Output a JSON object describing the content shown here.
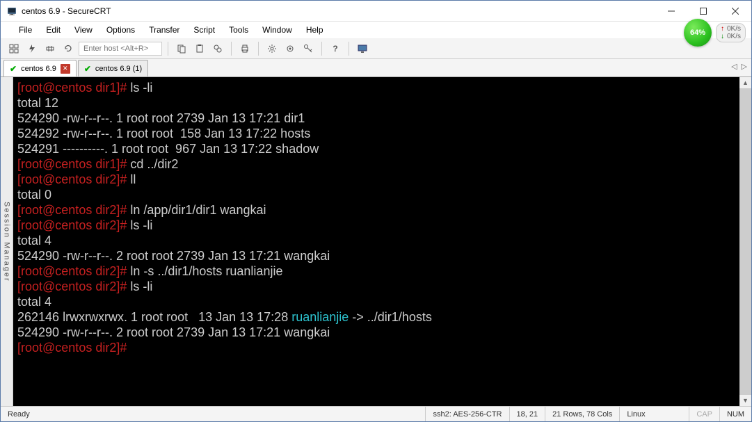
{
  "window": {
    "title": "centos 6.9 - SecureCRT"
  },
  "menu": [
    "File",
    "Edit",
    "View",
    "Options",
    "Transfer",
    "Script",
    "Tools",
    "Window",
    "Help"
  ],
  "speed": {
    "percent": "64%",
    "up": "0K/s",
    "down": "0K/s"
  },
  "toolbar": {
    "host_placeholder": "Enter host <Alt+R>"
  },
  "tabs": [
    {
      "label": "centos 6.9",
      "active": true,
      "close": true
    },
    {
      "label": "centos 6.9 (1)",
      "active": false,
      "close": false
    }
  ],
  "side_label": "Session Manager",
  "terminal": {
    "lines": [
      {
        "seg": [
          {
            "c": "p-red",
            "t": "[root@centos dir1]# "
          },
          {
            "c": "",
            "t": "ls -li"
          }
        ]
      },
      {
        "seg": [
          {
            "c": "",
            "t": "total 12"
          }
        ]
      },
      {
        "seg": [
          {
            "c": "",
            "t": "524290 -rw-r--r--. 1 root root 2739 Jan 13 17:21 dir1"
          }
        ]
      },
      {
        "seg": [
          {
            "c": "",
            "t": "524292 -rw-r--r--. 1 root root  158 Jan 13 17:22 hosts"
          }
        ]
      },
      {
        "seg": [
          {
            "c": "",
            "t": "524291 ----------. 1 root root  967 Jan 13 17:22 shadow"
          }
        ]
      },
      {
        "seg": [
          {
            "c": "p-red",
            "t": "[root@centos dir1]# "
          },
          {
            "c": "",
            "t": "cd ../dir2"
          }
        ]
      },
      {
        "seg": [
          {
            "c": "p-red",
            "t": "[root@centos dir2]# "
          },
          {
            "c": "",
            "t": "ll"
          }
        ]
      },
      {
        "seg": [
          {
            "c": "",
            "t": "total 0"
          }
        ]
      },
      {
        "seg": [
          {
            "c": "p-red",
            "t": "[root@centos dir2]# "
          },
          {
            "c": "",
            "t": "ln /app/dir1/dir1 wangkai"
          }
        ]
      },
      {
        "seg": [
          {
            "c": "p-red",
            "t": "[root@centos dir2]# "
          },
          {
            "c": "",
            "t": "ls -li"
          }
        ]
      },
      {
        "seg": [
          {
            "c": "",
            "t": "total 4"
          }
        ]
      },
      {
        "seg": [
          {
            "c": "",
            "t": "524290 -rw-r--r--. 2 root root 2739 Jan 13 17:21 wangkai"
          }
        ]
      },
      {
        "seg": [
          {
            "c": "p-red",
            "t": "[root@centos dir2]# "
          },
          {
            "c": "",
            "t": "ln -s ../dir1/hosts ruanlianjie"
          }
        ]
      },
      {
        "seg": [
          {
            "c": "p-red",
            "t": "[root@centos dir2]# "
          },
          {
            "c": "",
            "t": "ls -li"
          }
        ]
      },
      {
        "seg": [
          {
            "c": "",
            "t": "total 4"
          }
        ]
      },
      {
        "seg": [
          {
            "c": "",
            "t": "262146 lrwxrwxrwx. 1 root root   13 Jan 13 17:28 "
          },
          {
            "c": "p-cyan",
            "t": "ruanlianjie"
          },
          {
            "c": "",
            "t": " -> ../dir1/hosts"
          }
        ]
      },
      {
        "seg": [
          {
            "c": "",
            "t": "524290 -rw-r--r--. 2 root root 2739 Jan 13 17:21 wangkai"
          }
        ]
      },
      {
        "seg": [
          {
            "c": "p-red",
            "t": "[root@centos dir2]# "
          }
        ]
      }
    ]
  },
  "status": {
    "ready": "Ready",
    "proto": "ssh2: AES-256-CTR",
    "pos": "18,  21",
    "dim": "21 Rows, 78 Cols",
    "os": "Linux",
    "cap": "CAP",
    "num": "NUM"
  }
}
